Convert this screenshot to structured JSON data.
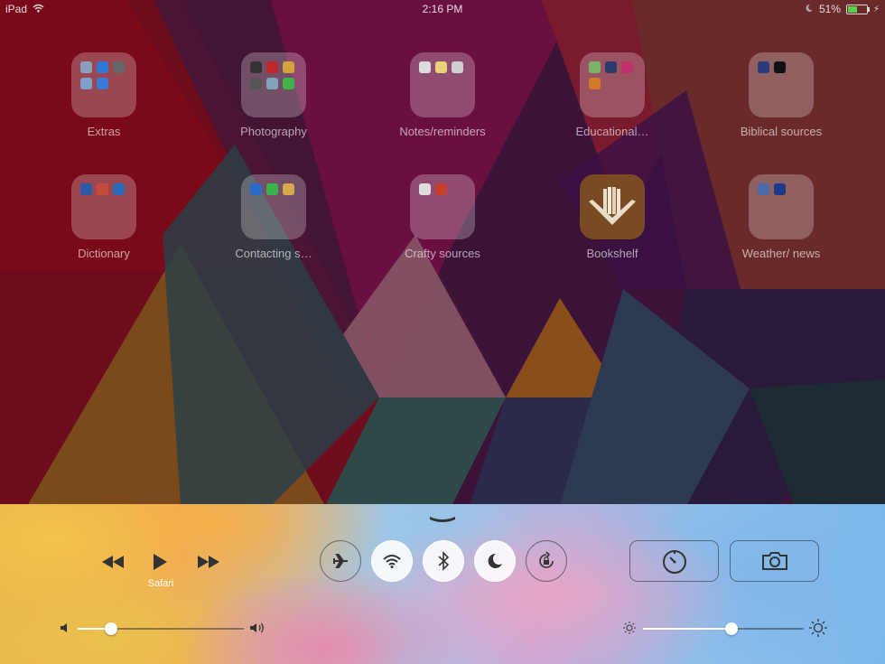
{
  "status_bar": {
    "device": "iPad",
    "time": "2:16 PM",
    "battery": "51%",
    "battery_fraction": 0.51
  },
  "home_screen": {
    "row1": [
      {
        "label": "Extras",
        "icon": "folder-icon"
      },
      {
        "label": "Photography",
        "icon": "folder-icon"
      },
      {
        "label": "Notes/reminders",
        "icon": "folder-icon"
      },
      {
        "label": "Educational…",
        "icon": "folder-icon"
      },
      {
        "label": "Biblical sources",
        "icon": "folder-icon"
      }
    ],
    "row2": [
      {
        "label": "Dictionary",
        "icon": "folder-icon"
      },
      {
        "label": "Contacting s…",
        "icon": "folder-icon"
      },
      {
        "label": "Crafty sources",
        "icon": "folder-icon"
      },
      {
        "label": "Bookshelf",
        "icon": "bookshelf-icon"
      },
      {
        "label": "Weather/ news",
        "icon": "folder-icon"
      }
    ]
  },
  "control_center": {
    "now_playing_app": "Safari",
    "toggles": [
      {
        "name": "airplane-mode",
        "on": false
      },
      {
        "name": "wifi",
        "on": true
      },
      {
        "name": "bluetooth",
        "on": true
      },
      {
        "name": "do-not-disturb",
        "on": true
      },
      {
        "name": "rotation-lock",
        "on": false
      }
    ],
    "volume_level": 0.2,
    "brightness_level": 0.55,
    "shortcuts": [
      "timer-icon",
      "camera-icon"
    ]
  },
  "colors": {
    "accent_on": "#ffffff",
    "battery_green": "#5ad14a"
  }
}
